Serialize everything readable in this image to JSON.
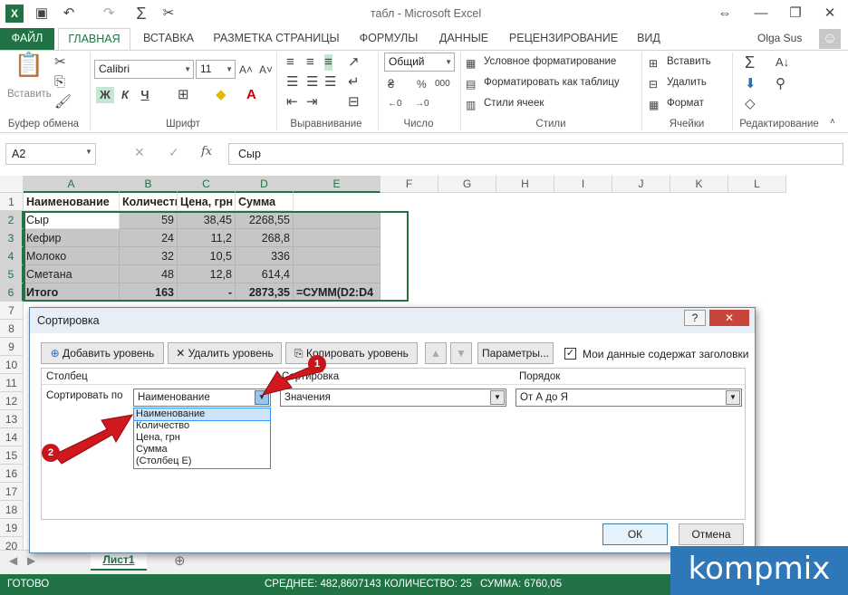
{
  "app": {
    "window_title": "табл - Microsoft Excel",
    "user": "Olga Sus"
  },
  "tabs": [
    "ФАЙЛ",
    "ГЛАВНАЯ",
    "ВСТАВКА",
    "РАЗМЕТКА СТРАНИЦЫ",
    "ФОРМУЛЫ",
    "ДАННЫЕ",
    "РЕЦЕНЗИРОВАНИЕ",
    "ВИД"
  ],
  "ribbon": {
    "clipboard": {
      "paste": "Вставить",
      "group": "Буфер обмена"
    },
    "font": {
      "name": "Calibri",
      "size": "11",
      "bold": "Ж",
      "italic": "К",
      "underline": "Ч",
      "group": "Шрифт"
    },
    "alignment": {
      "group": "Выравнивание"
    },
    "number": {
      "format": "Общий",
      "group": "Число"
    },
    "styles": {
      "conditional": "Условное форматирование",
      "as_table": "Форматировать как таблицу",
      "cell_styles": "Стили ячеек",
      "group": "Стили"
    },
    "cells": {
      "insert": "Вставить",
      "delete": "Удалить",
      "format": "Формат",
      "group": "Ячейки"
    },
    "editing": {
      "group": "Редактирование"
    }
  },
  "formula_bar": {
    "name_box": "A2",
    "fx": "fx",
    "value": "Сыр"
  },
  "columns": [
    "A",
    "B",
    "C",
    "D",
    "E",
    "F",
    "G",
    "H",
    "I",
    "J",
    "K",
    "L"
  ],
  "rows": [
    "1",
    "2",
    "3",
    "4",
    "5",
    "6",
    "7",
    "8",
    "9",
    "10",
    "11",
    "12",
    "13",
    "14",
    "15",
    "16",
    "17",
    "18",
    "19",
    "20"
  ],
  "sheet": {
    "header": [
      "Наименование",
      "Количество",
      "Цена, грн",
      "Сумма"
    ],
    "data": [
      [
        "Сыр",
        "59",
        "38,45",
        "2268,55"
      ],
      [
        "Кефир",
        "24",
        "11,2",
        "268,8"
      ],
      [
        "Молоко",
        "32",
        "10,5",
        "336"
      ],
      [
        "Сметана",
        "48",
        "12,8",
        "614,4"
      ],
      [
        "Итого",
        "163",
        "-",
        "2873,35"
      ]
    ],
    "e6": "=СУММ(D2:D4"
  },
  "dialog": {
    "title": "Сортировка",
    "help": "?",
    "close": "✕",
    "add_level": "Добавить уровень",
    "delete_level": "Удалить уровень",
    "copy_level": "Копировать уровень",
    "params": "Параметры...",
    "has_headers": "Мои данные содержат заголовки",
    "col_header": "Столбец",
    "sort_header": "Сортировка",
    "order_header": "Порядок",
    "sort_by": "Сортировать по",
    "column_value": "Наименование",
    "sort_on": "Значения",
    "order": "От А до Я",
    "options": [
      "Наименование",
      "Количество",
      "Цена, грн",
      "Сумма",
      "(Столбец E)"
    ],
    "ok": "ОК",
    "cancel": "Отмена"
  },
  "annotations": {
    "badge1": "1",
    "badge2": "2"
  },
  "sheet_tab": "Лист1",
  "status": {
    "ready": "ГОТОВО",
    "avg": "СРЕДНЕЕ: 482,8607143",
    "count": "КОЛИЧЕСТВО: 25",
    "sum": "СУММА: 6760,05"
  },
  "watermark": "kompmix",
  "colors": {
    "excel_green": "#217346",
    "selection": "#c6c6c6",
    "arrow_red": "#d0181f"
  }
}
